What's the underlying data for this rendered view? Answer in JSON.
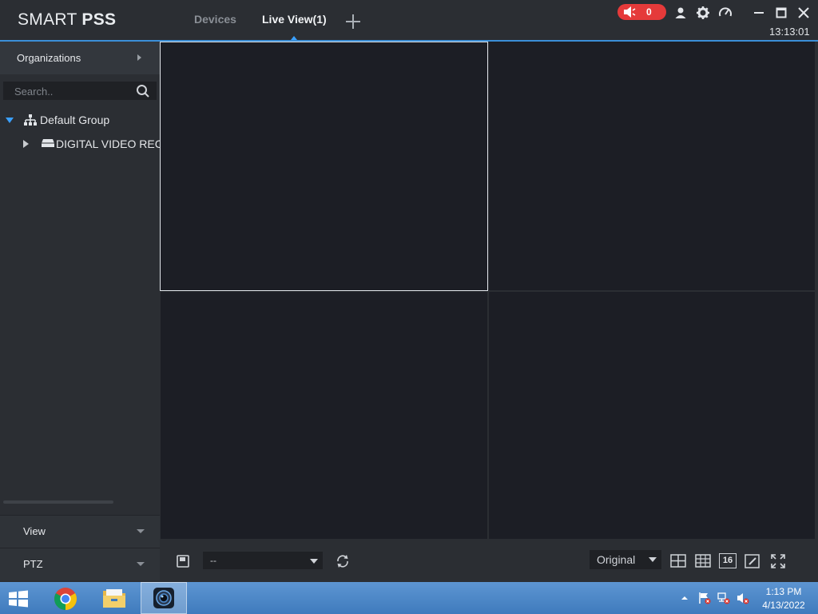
{
  "app": {
    "logo_thin": "SMART ",
    "logo_bold": "PSS",
    "tabs": [
      {
        "label": "Devices",
        "active": false
      },
      {
        "label": "Live View(1)",
        "active": true
      }
    ],
    "alarm_count": "0",
    "time": "13:13:01",
    "colors": {
      "accent": "#3aa0ff",
      "alarm": "#e53a3a",
      "video_bg": "#1c1e25"
    }
  },
  "sidebar": {
    "organizations_label": "Organizations",
    "search_placeholder": "Search..",
    "tree": {
      "group_label": "Default Group",
      "device_label": "DIGITAL VIDEO RECORDER"
    },
    "panels": [
      {
        "label": "View"
      },
      {
        "label": "PTZ"
      }
    ]
  },
  "toolbar": {
    "view_select_value": "--",
    "aspect_ratio_value": "Original",
    "layout_16_label": "16"
  },
  "taskbar": {
    "time": "1:13 PM",
    "date": "4/13/2022"
  }
}
